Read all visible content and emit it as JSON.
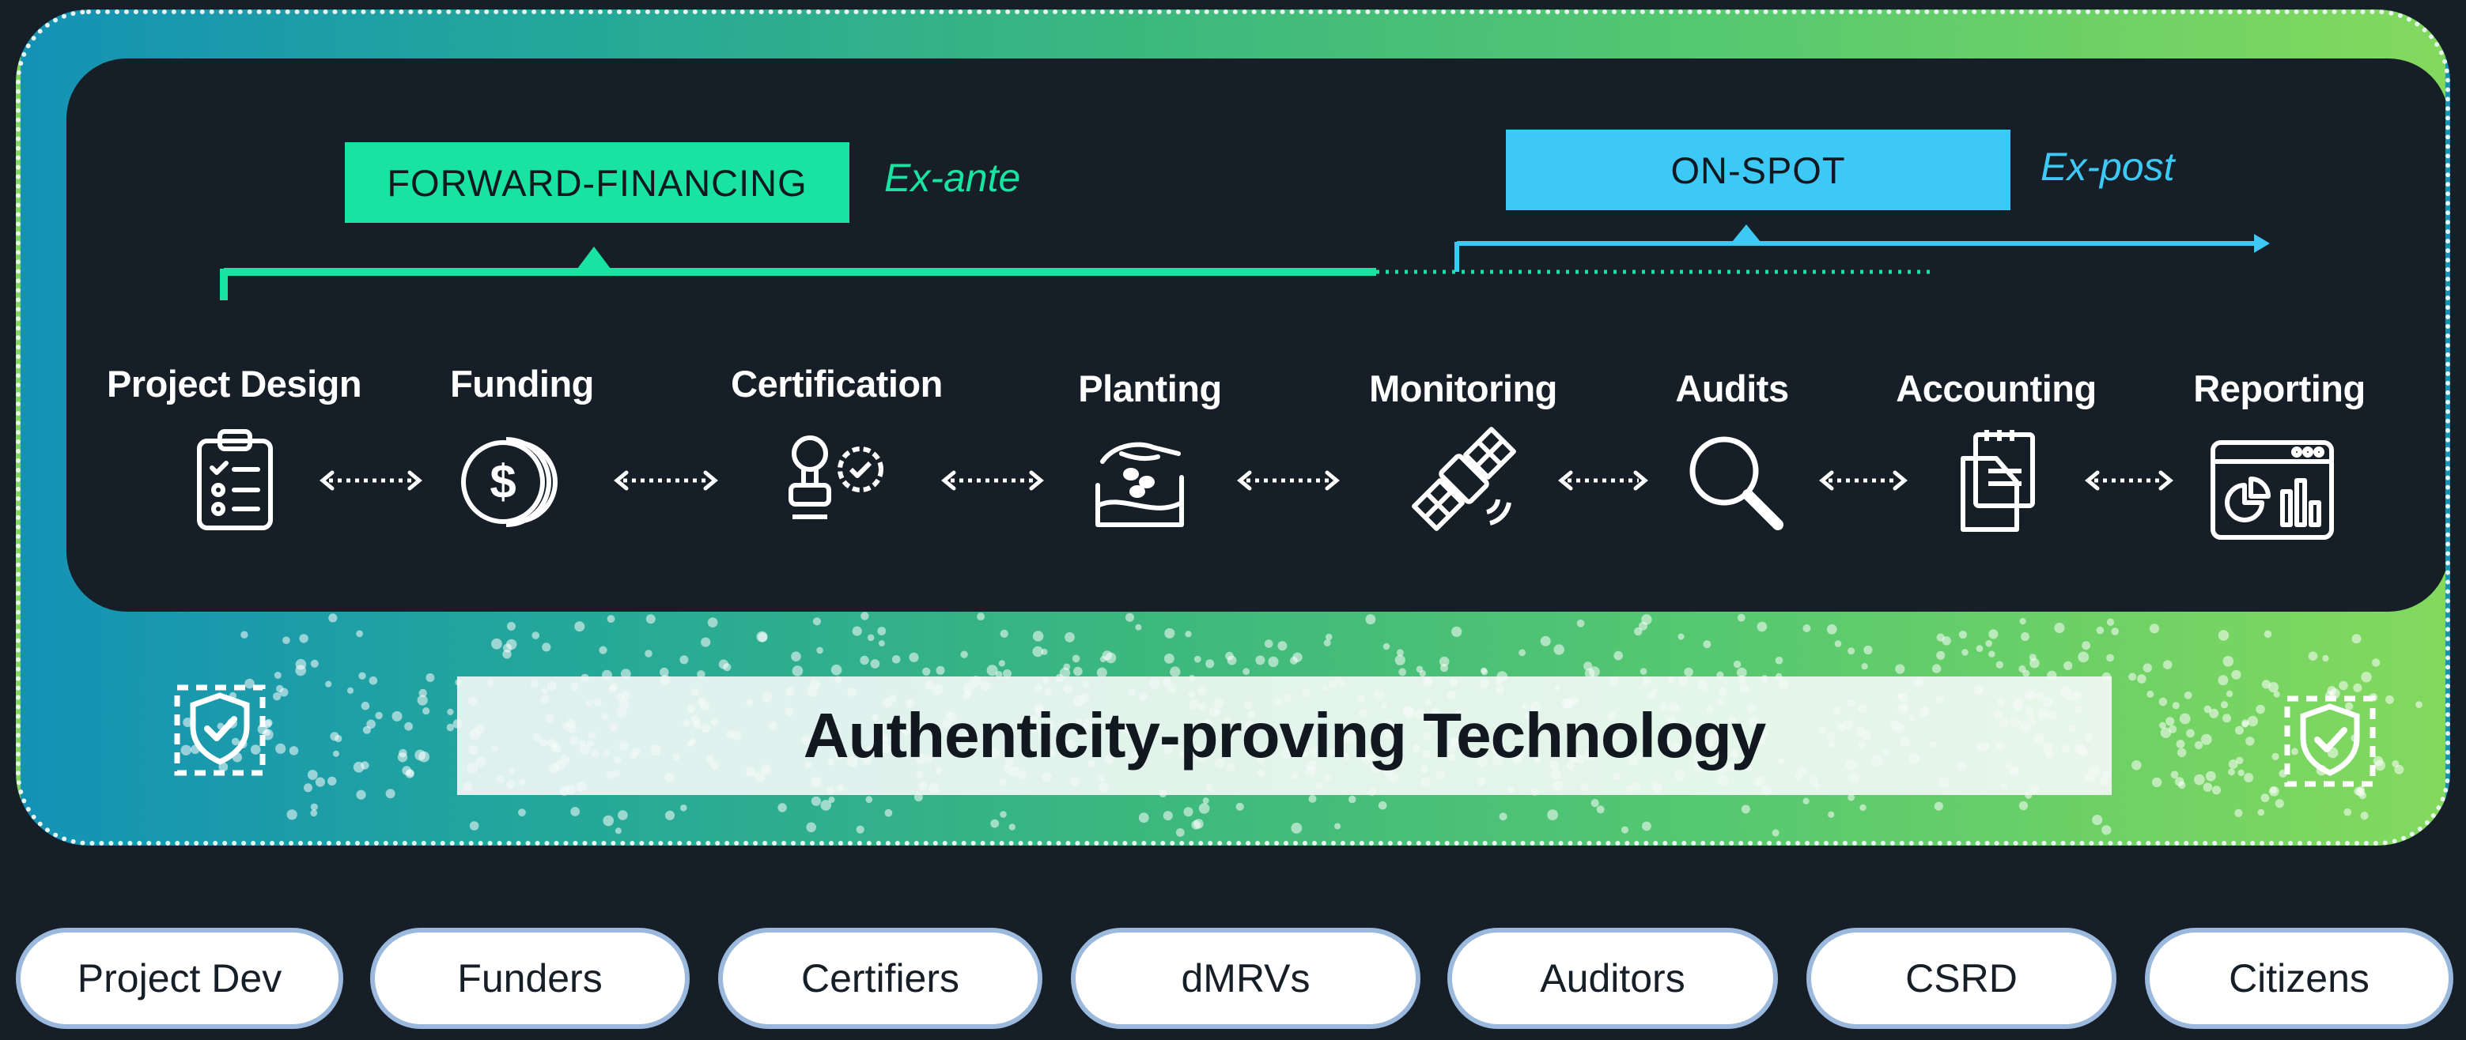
{
  "forward_financing": {
    "label": "FORWARD-FINANCING",
    "phase": "Ex-ante",
    "color": "#18e3a1"
  },
  "on_spot": {
    "label": "ON-SPOT",
    "phase": "Ex-post",
    "color": "#3dc9f6"
  },
  "steps": [
    {
      "label": "Project Design",
      "icon": "clipboard-checklist-icon"
    },
    {
      "label": "Funding",
      "icon": "coins-dollar-icon"
    },
    {
      "label": "Certification",
      "icon": "stamp-badge-icon"
    },
    {
      "label": "Planting",
      "icon": "hand-planting-icon"
    },
    {
      "label": "Monitoring",
      "icon": "satellite-icon"
    },
    {
      "label": "Audits",
      "icon": "magnifier-icon"
    },
    {
      "label": "Accounting",
      "icon": "documents-icon"
    },
    {
      "label": "Reporting",
      "icon": "dashboard-chart-icon"
    }
  ],
  "banner": {
    "title": "Authenticity-proving Technology",
    "icon": "shield-check-icon"
  },
  "stakeholders": [
    "Project Dev",
    "Funders",
    "Certifiers",
    "dMRVs",
    "Auditors",
    "CSRD",
    "Citizens"
  ],
  "colors": {
    "background": "#161e27",
    "gradient_start": "#1492b6",
    "gradient_end": "#83d95d"
  }
}
